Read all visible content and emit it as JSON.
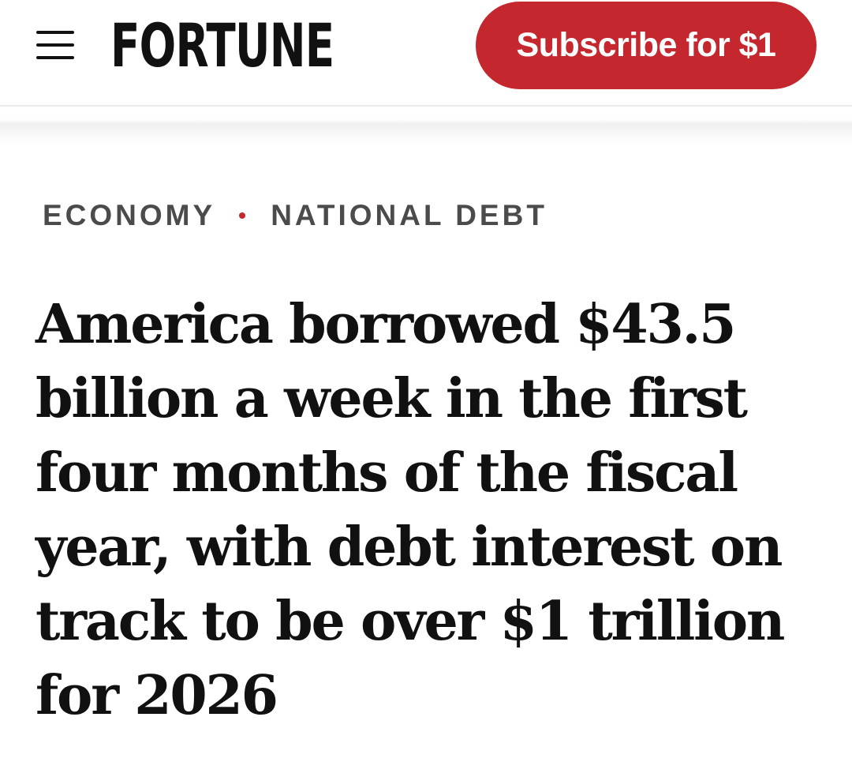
{
  "header": {
    "logo_text": "FORTUNE",
    "menu_icon": "hamburger-menu-icon",
    "subscribe_label": "Subscribe for $1",
    "subscribe_color": "#c4282e"
  },
  "breadcrumb": {
    "items": [
      "ECONOMY",
      "NATIONAL DEBT"
    ],
    "separator_color": "#c4282e"
  },
  "article": {
    "headline": "America borrowed $43.5 billion a week in the first four months of the fiscal year, with debt interest on track to be over $1 trillion for 2026"
  }
}
